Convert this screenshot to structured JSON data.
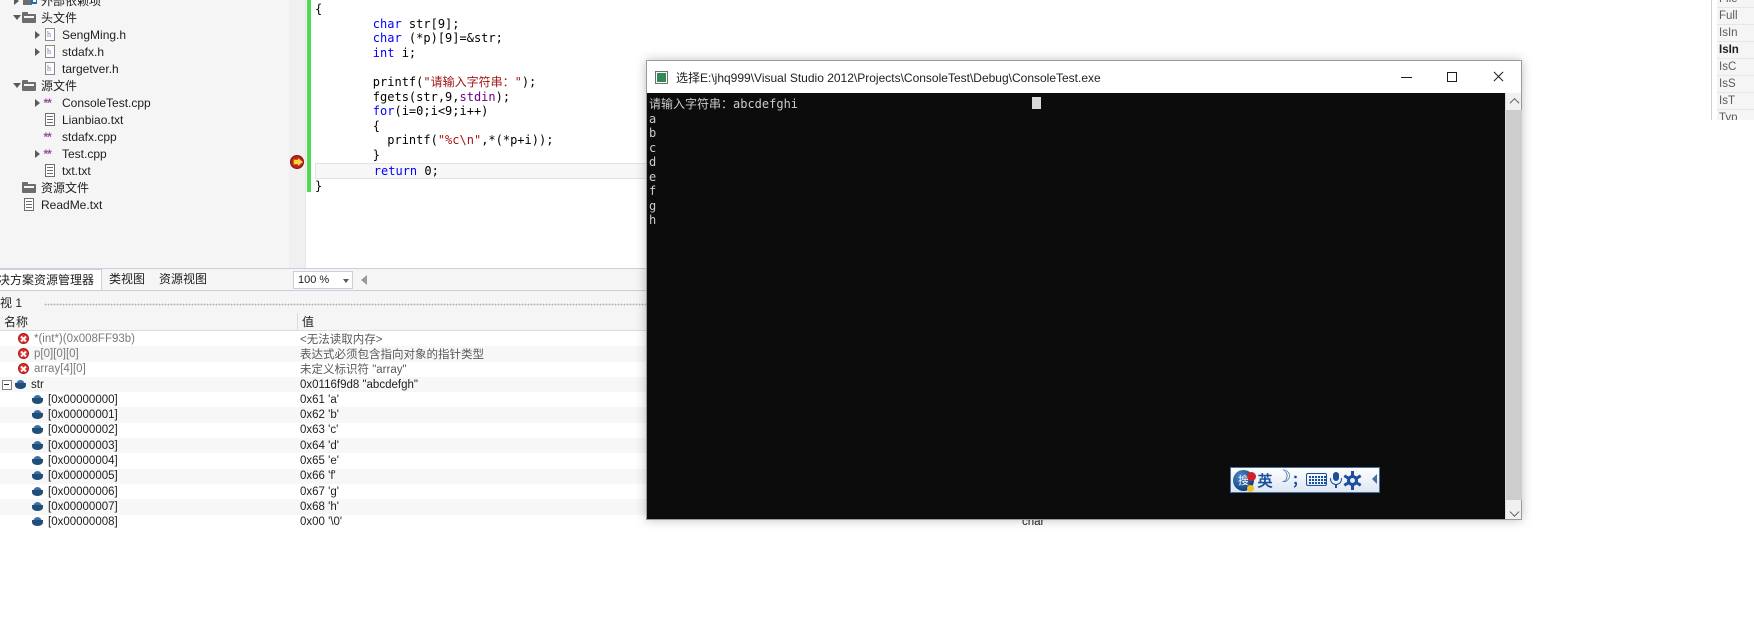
{
  "solution_explorer": {
    "tree": [
      {
        "label": "外部依赖项",
        "indent": 0,
        "twisty": "collapsed",
        "icon": "external-deps-icon",
        "clipped": true
      },
      {
        "label": "头文件",
        "indent": 0,
        "twisty": "expanded",
        "icon": "folder-icon"
      },
      {
        "label": "SengMing.h",
        "indent": 1,
        "twisty": "collapsed",
        "icon": "header-file-icon"
      },
      {
        "label": "stdafx.h",
        "indent": 1,
        "twisty": "collapsed",
        "icon": "header-file-icon"
      },
      {
        "label": "targetver.h",
        "indent": 1,
        "twisty": "none",
        "icon": "header-file-icon"
      },
      {
        "label": "源文件",
        "indent": 0,
        "twisty": "expanded",
        "icon": "folder-icon"
      },
      {
        "label": "ConsoleTest.cpp",
        "indent": 1,
        "twisty": "collapsed",
        "icon": "cpp-file-icon"
      },
      {
        "label": "Lianbiao.txt",
        "indent": 1,
        "twisty": "none",
        "icon": "text-file-icon"
      },
      {
        "label": "stdafx.cpp",
        "indent": 1,
        "twisty": "none",
        "icon": "cpp-file-icon"
      },
      {
        "label": "Test.cpp",
        "indent": 1,
        "twisty": "collapsed",
        "icon": "cpp-file-icon"
      },
      {
        "label": "txt.txt",
        "indent": 1,
        "twisty": "none",
        "icon": "text-file-icon"
      },
      {
        "label": "资源文件",
        "indent": 0,
        "twisty": "none",
        "icon": "folder-icon"
      },
      {
        "label": "ReadMe.txt",
        "indent": 0,
        "twisty": "none",
        "icon": "text-file-icon"
      }
    ],
    "tabs": [
      {
        "label": "决方案资源管理器",
        "active": true
      },
      {
        "label": "类视图",
        "active": false
      },
      {
        "label": "资源视图",
        "active": false
      }
    ]
  },
  "editor": {
    "zoom_level": "100 %",
    "lines": [
      {
        "segments": [
          {
            "t": "{",
            "c": ""
          }
        ]
      },
      {
        "segments": [
          {
            "t": "        ",
            "c": ""
          },
          {
            "t": "char",
            "c": "kw"
          },
          {
            "t": " str[9];",
            "c": ""
          }
        ]
      },
      {
        "segments": [
          {
            "t": "        ",
            "c": ""
          },
          {
            "t": "char",
            "c": "kw"
          },
          {
            "t": " (*p)[9]=&str;",
            "c": ""
          }
        ]
      },
      {
        "segments": [
          {
            "t": "        ",
            "c": ""
          },
          {
            "t": "int",
            "c": "kw"
          },
          {
            "t": " i;",
            "c": ""
          }
        ]
      },
      {
        "segments": [
          {
            "t": "",
            "c": ""
          }
        ]
      },
      {
        "segments": [
          {
            "t": "        printf(",
            "c": ""
          },
          {
            "t": "\"请输入字符串：\"",
            "c": "str"
          },
          {
            "t": ");",
            "c": ""
          }
        ]
      },
      {
        "segments": [
          {
            "t": "        fgets(str,9,",
            "c": ""
          },
          {
            "t": "stdin",
            "c": "mac"
          },
          {
            "t": ");",
            "c": ""
          }
        ]
      },
      {
        "segments": [
          {
            "t": "        ",
            "c": ""
          },
          {
            "t": "for",
            "c": "kw"
          },
          {
            "t": "(i=0;i<9;i++)",
            "c": ""
          }
        ]
      },
      {
        "segments": [
          {
            "t": "        {",
            "c": ""
          }
        ]
      },
      {
        "segments": [
          {
            "t": "          printf(",
            "c": ""
          },
          {
            "t": "\"%c\\n\"",
            "c": "str"
          },
          {
            "t": ",*(*p+i));",
            "c": ""
          }
        ]
      },
      {
        "segments": [
          {
            "t": "        }",
            "c": ""
          }
        ]
      },
      {
        "segments": [
          {
            "t": "        ",
            "c": ""
          },
          {
            "t": "return",
            "c": "kw"
          },
          {
            "t": " 0;",
            "c": ""
          }
        ],
        "current": true
      },
      {
        "segments": [
          {
            "t": "}",
            "c": ""
          }
        ]
      }
    ]
  },
  "watch_window": {
    "title": "视 1",
    "columns": {
      "name": "名称",
      "value": "值",
      "type": ""
    },
    "rows": [
      {
        "name": "*(int*)(0x008FF93b)",
        "value": "<无法读取内存>",
        "type": "",
        "icon": "error-icon",
        "indent": 1,
        "error": true
      },
      {
        "name": "p[0][0][0]",
        "value": "表达式必须包含指向对象的指针类型",
        "type": "",
        "icon": "error-icon",
        "indent": 1,
        "error": true
      },
      {
        "name": "array[4][0]",
        "value": "未定义标识符 \"array\"",
        "type": "",
        "icon": "error-icon",
        "indent": 1,
        "error": true
      },
      {
        "name": "str",
        "value": "0x0116f9d8 \"abcdefgh\"",
        "type": "",
        "icon": "variable-icon",
        "indent": 0,
        "expander": "minus"
      },
      {
        "name": "[0x00000000]",
        "value": "0x61 'a'",
        "type": "",
        "icon": "variable-icon",
        "indent": 2
      },
      {
        "name": "[0x00000001]",
        "value": "0x62 'b'",
        "type": "",
        "icon": "variable-icon",
        "indent": 2
      },
      {
        "name": "[0x00000002]",
        "value": "0x63 'c'",
        "type": "",
        "icon": "variable-icon",
        "indent": 2
      },
      {
        "name": "[0x00000003]",
        "value": "0x64 'd'",
        "type": "",
        "icon": "variable-icon",
        "indent": 2
      },
      {
        "name": "[0x00000004]",
        "value": "0x65 'e'",
        "type": "",
        "icon": "variable-icon",
        "indent": 2
      },
      {
        "name": "[0x00000005]",
        "value": "0x66 'f'",
        "type": "",
        "icon": "variable-icon",
        "indent": 2
      },
      {
        "name": "[0x00000006]",
        "value": "0x67 'g'",
        "type": "",
        "icon": "variable-icon",
        "indent": 2
      },
      {
        "name": "[0x00000007]",
        "value": "0x68 'h'",
        "type": "",
        "icon": "variable-icon",
        "indent": 2
      },
      {
        "name": "[0x00000008]",
        "value": "0x00 '\\0'",
        "type": "char",
        "icon": "variable-icon",
        "indent": 2
      }
    ]
  },
  "console": {
    "title": "选择E:\\jhq999\\Visual Studio 2012\\Projects\\ConsoleTest\\Debug\\ConsoleTest.exe",
    "output": "请输入字符串：abcdefghi\na\nb\nc\nd\ne\nf\ng\nh",
    "buttons": {
      "minimize": "—",
      "maximize": "□",
      "close": "✕"
    }
  },
  "properties_panel": {
    "rows": [
      {
        "label": "File",
        "bold": false
      },
      {
        "label": "Full",
        "bold": false
      },
      {
        "label": "IsIn",
        "bold": false
      },
      {
        "label": "IsIn",
        "bold": true
      },
      {
        "label": "IsC",
        "bold": false
      },
      {
        "label": "IsS",
        "bold": false
      },
      {
        "label": "IsT",
        "bold": false
      },
      {
        "label": "Typ",
        "bold": false
      }
    ]
  },
  "ime_toolbar": {
    "logo_char": "搜",
    "language": "英",
    "moon_mode": "moon-icon",
    "punctuation": "；",
    "keyboard": "keyboard-icon",
    "microphone": "microphone-icon",
    "settings": "gear-icon"
  }
}
